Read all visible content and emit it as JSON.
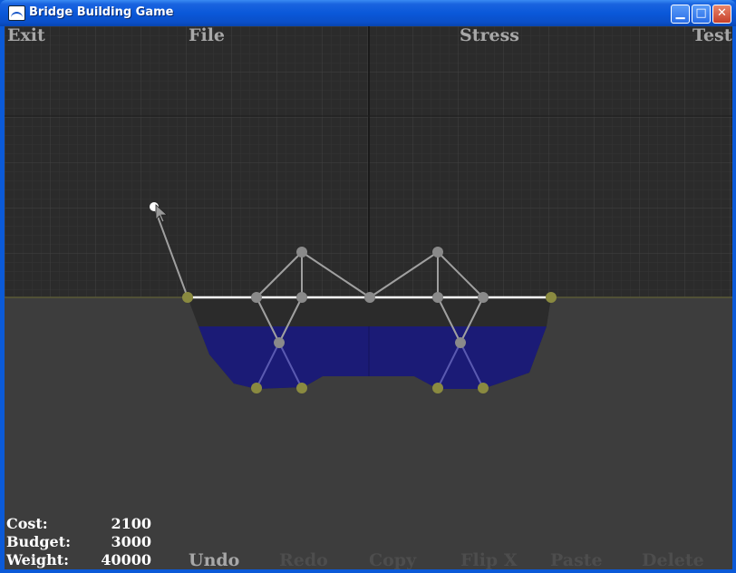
{
  "window": {
    "title": "Bridge Building Game"
  },
  "menu": {
    "exit": "Exit",
    "file": "File",
    "stress": "Stress",
    "test": "Test"
  },
  "toolbar": {
    "undo": "Undo",
    "redo": "Redo",
    "copy": "Copy",
    "flip_x": "Flip X",
    "paste": "Paste",
    "delete": "Delete"
  },
  "stats": {
    "cost_label": "Cost:",
    "cost": "2100",
    "budget_label": "Budget:",
    "budget": "3000",
    "weight_label": "Weight:",
    "weight": "40000"
  },
  "colors": {
    "grid_bg": "#2b2b2b",
    "ground": "#3d3d3d",
    "water": "#1a1a7a",
    "anchor_node": "#8a8a40",
    "node": "#8a8a8a",
    "road": "#ffffff",
    "member": "#a0a0a0"
  }
}
